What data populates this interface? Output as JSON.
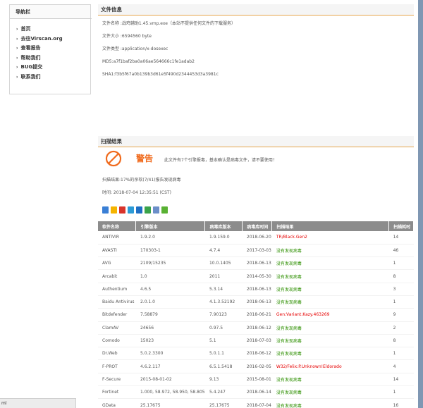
{
  "nav": {
    "title": "导航栏",
    "items": [
      "首页",
      "去往Virscan.org",
      "查看报告",
      "帮助我们",
      "BUG提交",
      "联系我们"
    ]
  },
  "file_info": {
    "title": "文件信息",
    "lines": [
      "文件名称 :战鸡辅助1.45.vmp.exe（本站不提供任何文件的下载服务）",
      "文件大小 :6594560 byte",
      "文件类型 :application/x-dosexec",
      "MD5:a7f1baf2ba0a06ae564666c1fe1adab2",
      "SHA1:f3b5f67a0b139b3d61e5f490d2344453d3a3981c"
    ]
  },
  "scan": {
    "title": "扫描结果",
    "warning_label": "警告",
    "warning_message": "此文件有7个引擎报毒，基本确认是病毒文件，请不要使用！",
    "summary": "扫描结果:17%的杀软(7/41)报告发现病毒",
    "time": "时间: 2018-07-04 12:35:51 (CST)",
    "share_colors": [
      "#3a7fd5",
      "#f5b400",
      "#d9342b",
      "#2c9bd6",
      "#1f6fc4",
      "#3aa34a",
      "#6c8fc9",
      "#59b133"
    ]
  },
  "table": {
    "headers": [
      "软件名称",
      "引擎版本",
      "病毒库版本",
      "病毒库时间",
      "扫描结果",
      "扫描耗时"
    ],
    "rows": [
      {
        "name": "ANTIVIR",
        "engine": "1.9.2.0",
        "db": "1.9.159.0",
        "date": "2018-06-20",
        "result": "TR/Black.Gen2",
        "infected": true,
        "time": "14"
      },
      {
        "name": "AVASTI",
        "engine": "170303-1",
        "db": "4.7.4",
        "date": "2017-03-03",
        "result": "没有发现病毒",
        "infected": false,
        "time": "46"
      },
      {
        "name": "AVG",
        "engine": "2109/15235",
        "db": "10.0.1405",
        "date": "2018-06-13",
        "result": "没有发现病毒",
        "infected": false,
        "time": "1"
      },
      {
        "name": "Arcabit",
        "engine": "1.0",
        "db": "2011",
        "date": "2014-05-30",
        "result": "没有发现病毒",
        "infected": false,
        "time": "8"
      },
      {
        "name": "Authentium",
        "engine": "4.6.5",
        "db": "5.3.14",
        "date": "2018-06-13",
        "result": "没有发现病毒",
        "infected": false,
        "time": "3"
      },
      {
        "name": "Baidu Antivirus",
        "engine": "2.0.1.0",
        "db": "4.1.3.52192",
        "date": "2018-06-13",
        "result": "没有发现病毒",
        "infected": false,
        "time": "1"
      },
      {
        "name": "Bitdefender",
        "engine": "7.58879",
        "db": "7.90123",
        "date": "2018-06-21",
        "result": "Gen:Variant.Kazy.463269",
        "infected": true,
        "time": "9"
      },
      {
        "name": "ClamAV",
        "engine": "24656",
        "db": "0.97.5",
        "date": "2018-06-12",
        "result": "没有发现病毒",
        "infected": false,
        "time": "2"
      },
      {
        "name": "Comodo",
        "engine": "15023",
        "db": "5.1",
        "date": "2018-07-03",
        "result": "没有发现病毒",
        "infected": false,
        "time": "8"
      },
      {
        "name": "Dr.Web",
        "engine": "5.0.2.3300",
        "db": "5.0.1.1",
        "date": "2018-06-12",
        "result": "没有发现病毒",
        "infected": false,
        "time": "1"
      },
      {
        "name": "F-PROT",
        "engine": "4.6.2.117",
        "db": "6.5.1.5418",
        "date": "2016-02-05",
        "result": "W32/Felix:P.Unknown!Eldorado",
        "infected": true,
        "time": "4"
      },
      {
        "name": "F-Secure",
        "engine": "2015-08-01-02",
        "db": "9.13",
        "date": "2015-08-01",
        "result": "没有发现病毒",
        "infected": false,
        "time": "14"
      },
      {
        "name": "Fortinet",
        "engine": "1.000, 58.972, 58.950, 58.805",
        "db": "5.4.247",
        "date": "2018-06-14",
        "result": "没有发现病毒",
        "infected": false,
        "time": "1"
      },
      {
        "name": "GData",
        "engine": "25.17675",
        "db": "25.17675",
        "date": "2018-07-04",
        "result": "没有发现病毒",
        "infected": false,
        "time": "16"
      }
    ]
  },
  "statusbar": {
    "text": "ml"
  }
}
